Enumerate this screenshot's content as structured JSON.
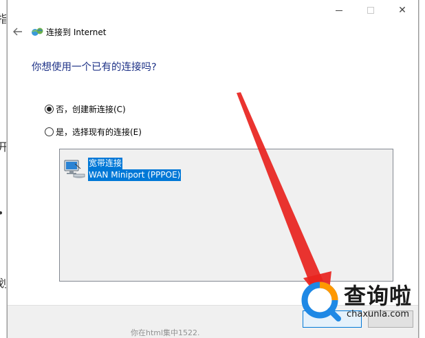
{
  "background_window": {
    "left_fragments": [
      "指",
      "开",
      "•",
      "划"
    ]
  },
  "dialog": {
    "header": {
      "back_icon": "back-arrow-icon",
      "app_icon": "internet-connection-icon",
      "title": "连接到 Internet"
    },
    "caption_buttons": {
      "minimize_icon": "minimize-icon",
      "maximize_icon": "maximize-icon",
      "close_icon": "close-icon",
      "close_glyph": "✕"
    },
    "question": "你想使用一个已有的连接吗?",
    "options": [
      {
        "label": "否，创建新连接(C)",
        "selected": true
      },
      {
        "label": "是，选择现有的连接(E)",
        "selected": false
      }
    ],
    "connections": [
      {
        "name": "宽带连接",
        "device": "WAN Miniport (PPPOE)",
        "icon": "network-computer-icon",
        "selected": true
      }
    ]
  },
  "watermark": {
    "chinese": "查询啦",
    "domain": "chaxunla.com"
  },
  "background_bottom_text": "你在html集中1522.",
  "colors": {
    "accent": "#0078d7",
    "heading": "#1e3287",
    "arrow": "#e8231e",
    "watermark_blue": "#1e88e5",
    "watermark_orange": "#ff9800"
  }
}
